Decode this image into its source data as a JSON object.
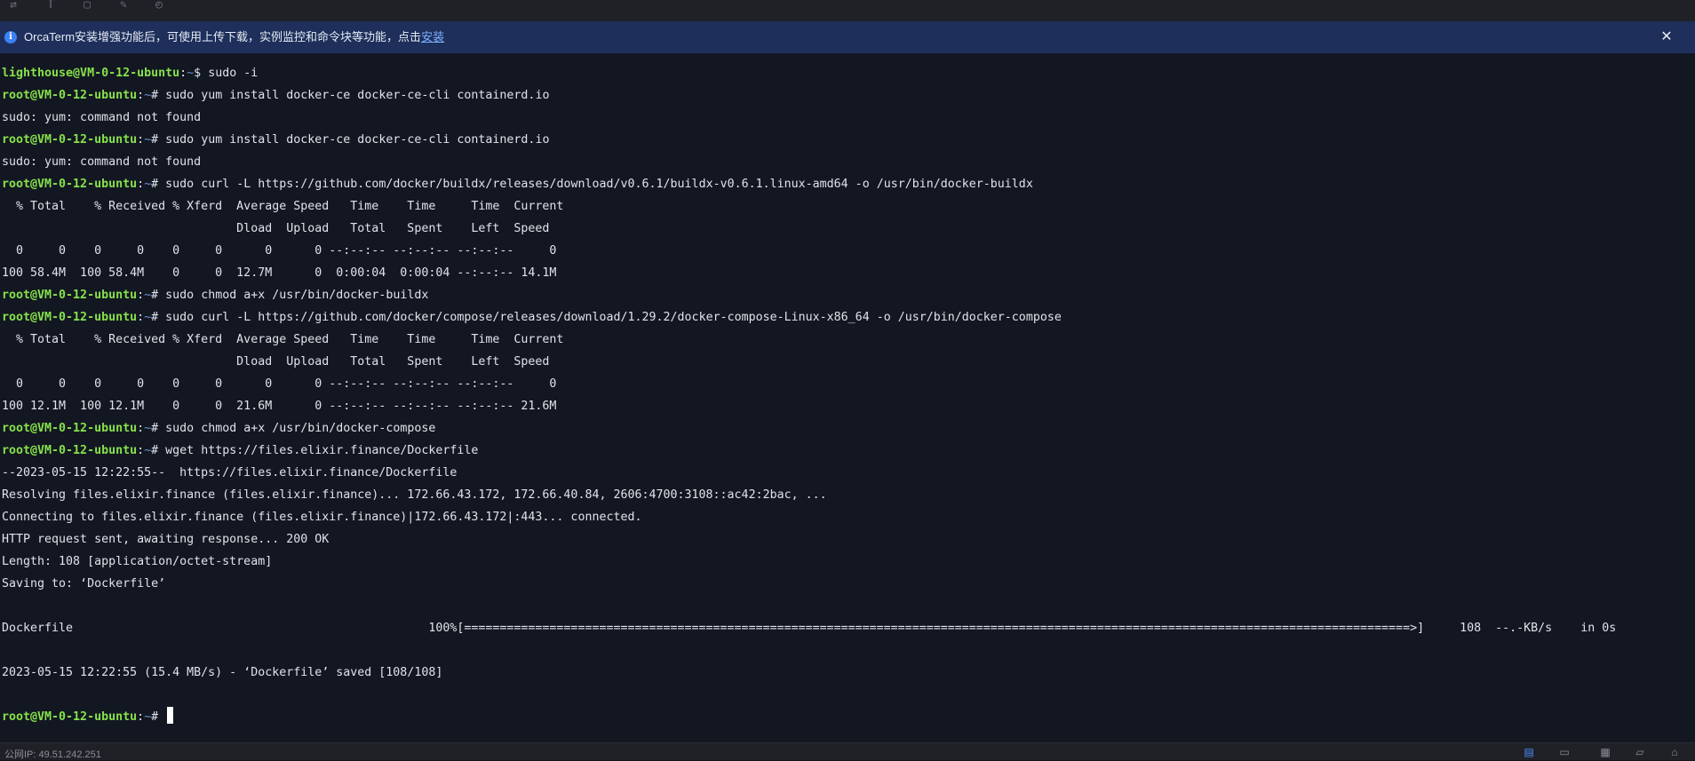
{
  "toolbar": {
    "icons": [
      "sync-icon",
      "text-icon",
      "file-icon",
      "edit-icon",
      "history-icon"
    ],
    "glyphs": [
      "⇄",
      "T",
      "▢",
      "✎",
      "◴"
    ]
  },
  "banner": {
    "message": "OrcaTerm安装增强功能后，可使用上传下载，实例监控和命令块等功能，点击",
    "link": "安装",
    "close": "✕"
  },
  "terminal": {
    "user": "lighthouse",
    "root_user": "root",
    "host": "@VM-0-12-ubuntu",
    "path": "~",
    "lines": [
      {
        "type": "prompt",
        "user": "lighthouse@VM-0-12-ubuntu",
        "sym": "$",
        "cmd": " sudo -i"
      },
      {
        "type": "prompt",
        "user": "root@VM-0-12-ubuntu",
        "sym": "#",
        "cmd": " sudo yum install docker-ce docker-ce-cli containerd.io"
      },
      {
        "type": "output",
        "text": "sudo: yum: command not found"
      },
      {
        "type": "prompt",
        "user": "root@VM-0-12-ubuntu",
        "sym": "#",
        "cmd": " sudo yum install docker-ce docker-ce-cli containerd.io"
      },
      {
        "type": "output",
        "text": "sudo: yum: command not found"
      },
      {
        "type": "prompt",
        "user": "root@VM-0-12-ubuntu",
        "sym": "#",
        "cmd": " sudo curl -L https://github.com/docker/buildx/releases/download/v0.6.1/buildx-v0.6.1.linux-amd64 -o /usr/bin/docker-buildx"
      },
      {
        "type": "output",
        "text": "  % Total    % Received % Xferd  Average Speed   Time    Time     Time  Current"
      },
      {
        "type": "output",
        "text": "                                 Dload  Upload   Total   Spent    Left  Speed"
      },
      {
        "type": "output",
        "text": "  0     0    0     0    0     0      0      0 --:--:-- --:--:-- --:--:--     0"
      },
      {
        "type": "output",
        "text": "100 58.4M  100 58.4M    0     0  12.7M      0  0:00:04  0:00:04 --:--:-- 14.1M"
      },
      {
        "type": "prompt",
        "user": "root@VM-0-12-ubuntu",
        "sym": "#",
        "cmd": " sudo chmod a+x /usr/bin/docker-buildx"
      },
      {
        "type": "prompt",
        "user": "root@VM-0-12-ubuntu",
        "sym": "#",
        "cmd": " sudo curl -L https://github.com/docker/compose/releases/download/1.29.2/docker-compose-Linux-x86_64 -o /usr/bin/docker-compose"
      },
      {
        "type": "output",
        "text": "  % Total    % Received % Xferd  Average Speed   Time    Time     Time  Current"
      },
      {
        "type": "output",
        "text": "                                 Dload  Upload   Total   Spent    Left  Speed"
      },
      {
        "type": "output",
        "text": "  0     0    0     0    0     0      0      0 --:--:-- --:--:-- --:--:--     0"
      },
      {
        "type": "output",
        "text": "100 12.1M  100 12.1M    0     0  21.6M      0 --:--:-- --:--:-- --:--:-- 21.6M"
      },
      {
        "type": "prompt",
        "user": "root@VM-0-12-ubuntu",
        "sym": "#",
        "cmd": " sudo chmod a+x /usr/bin/docker-compose"
      },
      {
        "type": "prompt",
        "user": "root@VM-0-12-ubuntu",
        "sym": "#",
        "cmd": " wget https://files.elixir.finance/Dockerfile"
      },
      {
        "type": "output",
        "text": "--2023-05-15 12:22:55--  https://files.elixir.finance/Dockerfile"
      },
      {
        "type": "output",
        "text": "Resolving files.elixir.finance (files.elixir.finance)... 172.66.43.172, 172.66.40.84, 2606:4700:3108::ac42:2bac, ..."
      },
      {
        "type": "output",
        "text": "Connecting to files.elixir.finance (files.elixir.finance)|172.66.43.172|:443... connected."
      },
      {
        "type": "output",
        "text": "HTTP request sent, awaiting response... 200 OK"
      },
      {
        "type": "output",
        "text": "Length: 108 [application/octet-stream]"
      },
      {
        "type": "output",
        "text": "Saving to: ‘Dockerfile’"
      },
      {
        "type": "output",
        "text": ""
      },
      {
        "type": "output",
        "text": "Dockerfile                                                  100%[=====================================================================================================================================>]     108  --.-KB/s    in 0s"
      },
      {
        "type": "output",
        "text": ""
      },
      {
        "type": "output",
        "text": "2023-05-15 12:22:55 (15.4 MB/s) - ‘Dockerfile’ saved [108/108]"
      },
      {
        "type": "output",
        "text": ""
      },
      {
        "type": "prompt",
        "user": "root@VM-0-12-ubuntu",
        "sym": "#",
        "cmd": " ",
        "cursor": true
      }
    ]
  },
  "statusbar": {
    "public_ip": "公网IP: 49.51.242.251",
    "icons": [
      "terminal-icon",
      "window-icon",
      "calendar-icon",
      "folder-icon",
      "home-icon"
    ],
    "glyphs": [
      "▤",
      "▭",
      "▦",
      "▱",
      "⌂"
    ]
  },
  "colors": {
    "background": "#131722",
    "prompt_user": "#86e24a",
    "prompt_path": "#6f8fd8",
    "banner_bg": "#1d2f5a",
    "link": "#7fb2ff"
  }
}
